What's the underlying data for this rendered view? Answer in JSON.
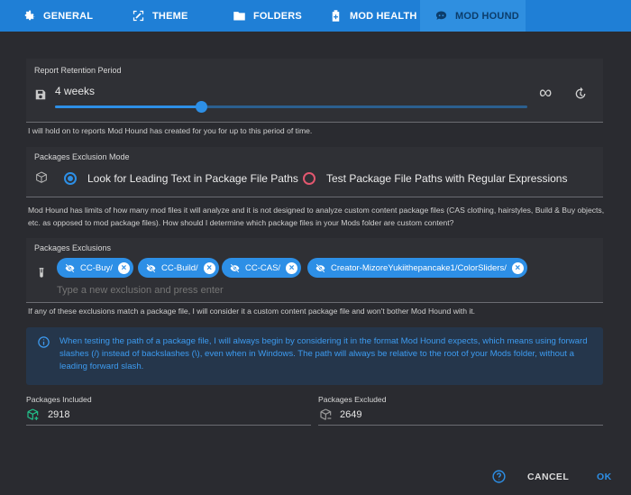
{
  "tabs": [
    {
      "label": "GENERAL",
      "icon": "gear-icon"
    },
    {
      "label": "THEME",
      "icon": "paint-icon"
    },
    {
      "label": "FOLDERS",
      "icon": "folder-icon"
    },
    {
      "label": "MOD HEALTH",
      "icon": "medkit-icon"
    },
    {
      "label": "MOD HOUND",
      "icon": "hound-icon",
      "active": true
    }
  ],
  "retention": {
    "label": "Report Retention Period",
    "value": "4 weeks",
    "slider_fraction": 0.31,
    "helper": "I will hold on to reports Mod Hound has created for you for up to this period of time."
  },
  "exclusion_mode": {
    "label": "Packages Exclusion Mode",
    "options": [
      "Look for Leading Text in Package File Paths",
      "Test Package File Paths with Regular Expressions"
    ],
    "selected": 0,
    "helper": "Mod Hound has limits of how many mod files it will analyze and it is not designed to analyze custom content package files (CAS clothing, hairstyles, Build & Buy objects, etc. as opposed to mod package files). How should I determine which package files in your Mods folder are custom content?"
  },
  "exclusions": {
    "label": "Packages Exclusions",
    "chips": [
      "CC-Buy/",
      "CC-Build/",
      "CC-CAS/",
      "Creator-MizoreYukiithepancake1/ColorSliders/"
    ],
    "placeholder": "Type a new exclusion and press enter",
    "helper": "If any of these exclusions match a package file, I will consider it a custom content package file and won't bother Mod Hound with it."
  },
  "info": "When testing the path of a package file, I will always begin by considering it in the format Mod Hound expects, which means using forward slashes (/) instead of backslashes (\\), even when in Windows. The path will always be relative to the root of your Mods folder, without a leading forward slash.",
  "stats": {
    "included_label": "Packages Included",
    "included_value": "2918",
    "excluded_label": "Packages Excluded",
    "excluded_value": "2649"
  },
  "buttons": {
    "cancel": "CANCEL",
    "ok": "OK"
  },
  "colors": {
    "accent": "#2d8fe6",
    "tabbar": "#1f7fd6",
    "danger": "#e2576f",
    "success": "#22c08a"
  }
}
